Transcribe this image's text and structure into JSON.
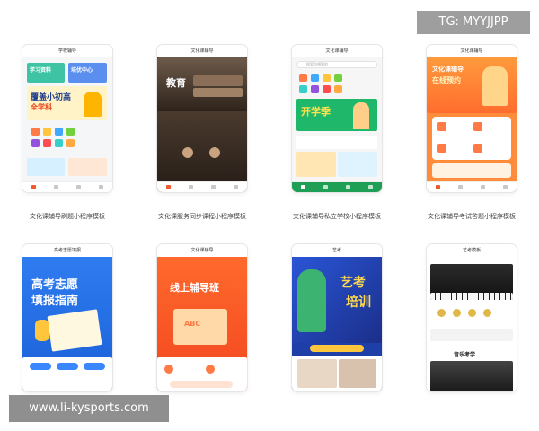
{
  "watermark_top": "TG: MYYJJPP",
  "watermark_bottom": "www.li-kysports.com",
  "templates": [
    {
      "caption": "文化课辅导刷题小程序模板",
      "title": "学校辅导",
      "headline": "覆盖小初高",
      "subhead": "全学科",
      "tag1": "学习资料",
      "tag2": "培优中心",
      "accent": "#ffb400"
    },
    {
      "caption": "文化课服务同步课程小程序模板",
      "title": "文化课辅导",
      "headline": "教育"
    },
    {
      "caption": "文化课辅导私立学校小程序模板",
      "title": "文化课辅导",
      "search_placeholder": "搜索你想要的",
      "banner": "开学季"
    },
    {
      "caption": "文化课辅导考试答题小程序模板",
      "title": "文化课辅导",
      "headline": "文化课辅导",
      "subhead": "在线预约"
    },
    {
      "caption": "",
      "title": "高考志愿填报",
      "headline": "高考志愿",
      "subhead": "填报指南"
    },
    {
      "caption": "",
      "title": "文化课辅导",
      "headline": "线上辅导班",
      "small": "ABC"
    },
    {
      "caption": "",
      "title": "艺考",
      "headline": "艺考",
      "subhead": "培训"
    },
    {
      "caption": "",
      "title": "艺考模板",
      "section": "音乐考学"
    }
  ]
}
